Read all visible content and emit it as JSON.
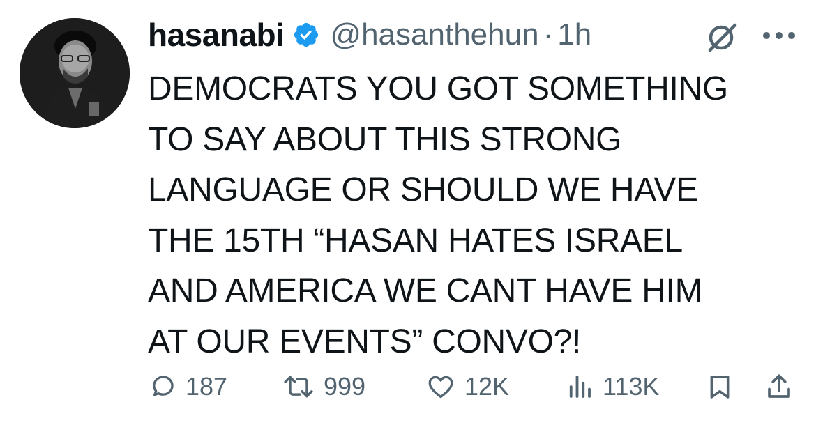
{
  "tweet": {
    "author_name": "hasanabi",
    "handle": "@hasanthehun",
    "separator": "·",
    "time": "1h",
    "text": "DEMOCRATS YOU GOT SOMETHING\nTO SAY ABOUT THIS STRONG\nLANGUAGE OR SHOULD WE HAVE\nTHE 15TH “HASAN HATES ISRAEL\nAND AMERICA WE CANT HAVE HIM\nAT OUR EVENTS” CONVO?!"
  },
  "actions": {
    "replies": "187",
    "reposts": "999",
    "likes": "12K",
    "views": "113K"
  },
  "icons": {
    "verified": "verified-badge-icon",
    "grok": "grok-icon",
    "more": "more-icon",
    "reply": "reply-icon",
    "repost": "repost-icon",
    "like": "like-icon",
    "views": "views-icon",
    "bookmark": "bookmark-icon",
    "share": "share-icon"
  },
  "colors": {
    "text": "#0f1419",
    "secondary": "#536471",
    "verified": "#1d9bf0"
  }
}
